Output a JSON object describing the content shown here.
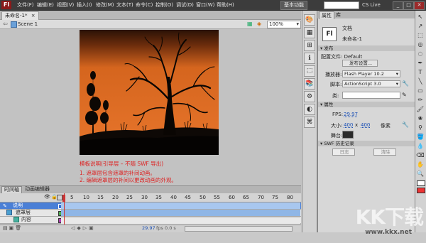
{
  "menubar": {
    "logo": "Fl",
    "items": [
      "文件(F)",
      "编辑(E)",
      "视图(V)",
      "插入(I)",
      "修改(M)",
      "文本(T)",
      "命令(C)",
      "控制(O)",
      "调试(D)",
      "窗口(W)",
      "帮助(H)"
    ],
    "workspace": "基本功能",
    "cslive": "CS Live",
    "window_buttons": [
      "_",
      "□",
      "✕"
    ]
  },
  "document": {
    "tab_label": "未命名-1*",
    "tab_close": "×",
    "scene_label": "Scene 1",
    "zoom": "100%"
  },
  "stage": {
    "notes": [
      "模板说明(引导层 – 不随 SWF 导出)",
      "1. 遮罩层包含遮罩的补间动画。",
      "2. 编辑遮罩层的补间以更改动画的外观。"
    ]
  },
  "timeline": {
    "tabs": [
      "时间轴",
      "动画编辑器"
    ],
    "frame_numbers": [
      "5",
      "10",
      "15",
      "20",
      "25",
      "30",
      "35",
      "40",
      "45",
      "50",
      "55",
      "60",
      "65",
      "70",
      "75",
      "80"
    ],
    "layers": [
      {
        "name": "说明",
        "color": "#3b6fd6"
      },
      {
        "name": "遮罩层",
        "color": "#4caf50"
      },
      {
        "name": "内容",
        "color": "#b03ab0"
      }
    ],
    "footer_fps": "29.97",
    "footer_fps_unit": "fps",
    "footer_time": "0.0 s"
  },
  "properties": {
    "tabs": [
      "属性",
      "库"
    ],
    "doc_icon": "Fl",
    "doc_type": "文档",
    "doc_name": "未命名-1",
    "sections": {
      "publish": "发布",
      "properties": "属性",
      "swf_history": "SWF 历史记录"
    },
    "profile": "配置文件: Default",
    "publish_settings": "发布设置...",
    "player_label": "播放器:",
    "player_value": "Flash Player 10.2",
    "script_label": "脚本:",
    "script_value": "ActionScript 3.0",
    "class_label": "类:",
    "fps_label": "FPS:",
    "fps_value": "29.97",
    "size_label": "大小:",
    "width": "400",
    "x_sep": "x",
    "height": "400",
    "unit": "像素",
    "stage_label": "舞台:",
    "stage_color": "#2a2a2a",
    "log_button": "日志",
    "clear_button": "清除"
  },
  "watermark": {
    "text": "KK下载",
    "url": "www.kkx.net"
  }
}
